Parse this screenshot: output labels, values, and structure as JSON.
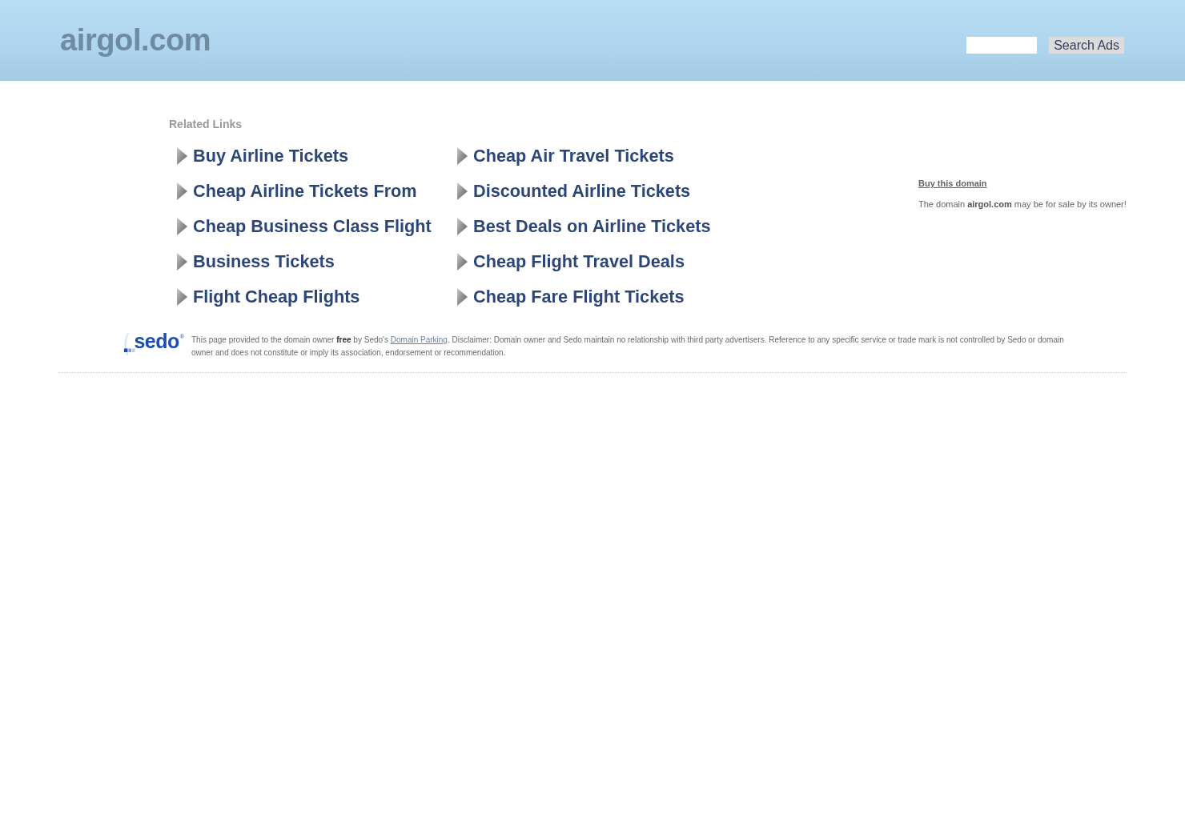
{
  "header": {
    "logo": "airgol.com",
    "search": {
      "button": "Search Ads"
    }
  },
  "related_links": {
    "title": "Related Links",
    "columns": [
      [
        "Buy Airline Tickets",
        "Cheap Airline Tickets From",
        "Cheap Business Class Flight",
        "Business Tickets",
        "Flight Cheap Flights"
      ],
      [
        "Cheap Air Travel Tickets",
        "Discounted Airline Tickets",
        "Best Deals on Airline Tickets",
        "Cheap Flight Travel Deals",
        "Cheap Fare Flight Tickets"
      ]
    ]
  },
  "sale_box": {
    "link": "Buy this domain",
    "text": "The domain **airgol.com** may be for sale by its owner!"
  },
  "footer": {
    "logo": {
      "name": "sedo",
      "mark": "®"
    },
    "disclaimer": {
      "before": "This page provided to the domain owner **free** by Sedo's ",
      "link": "Domain Parking",
      "after": ". Disclaimer: Domain owner and Sedo maintain no relationship with third party advertisers. Reference to any specific service or trade mark is not controlled by Sedo or domain owner and does not constitute or imply its association, endorsement or recommendation."
    }
  }
}
